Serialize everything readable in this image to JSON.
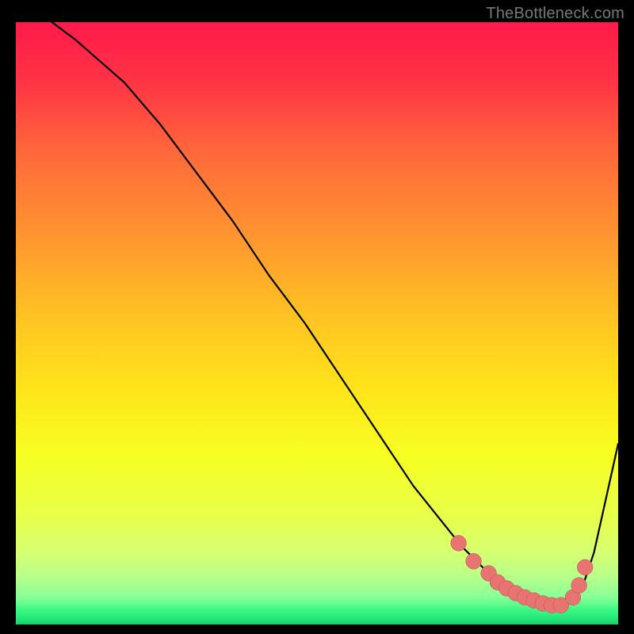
{
  "watermark": "TheBottleneck.com",
  "colors": {
    "background": "#000000",
    "watermark_text": "#777777",
    "curve_stroke": "#000000",
    "marker_fill": "#E77471",
    "marker_stroke": "#C0504D",
    "gradient_stops": [
      {
        "offset": 0.0,
        "color": "#FF1A4A"
      },
      {
        "offset": 0.1,
        "color": "#FF3445"
      },
      {
        "offset": 0.22,
        "color": "#FF6A3A"
      },
      {
        "offset": 0.35,
        "color": "#FF9330"
      },
      {
        "offset": 0.48,
        "color": "#FFC024"
      },
      {
        "offset": 0.6,
        "color": "#FFE21A"
      },
      {
        "offset": 0.72,
        "color": "#F7FF22"
      },
      {
        "offset": 0.82,
        "color": "#E8FF4A"
      },
      {
        "offset": 0.88,
        "color": "#D6FF70"
      },
      {
        "offset": 0.92,
        "color": "#B8FF8A"
      },
      {
        "offset": 0.955,
        "color": "#88FF98"
      },
      {
        "offset": 0.975,
        "color": "#40F884"
      },
      {
        "offset": 0.99,
        "color": "#22E77A"
      },
      {
        "offset": 1.0,
        "color": "#16D268"
      }
    ]
  },
  "chart_data": {
    "type": "line",
    "title": "",
    "xlabel": "",
    "ylabel": "",
    "xlim": [
      0,
      100
    ],
    "ylim": [
      0,
      100
    ],
    "grid": false,
    "legend": false,
    "series": [
      {
        "name": "curve",
        "x": [
          6,
          10,
          14,
          18,
          24,
          30,
          36,
          42,
          48,
          54,
          58,
          62,
          66,
          70,
          74,
          78,
          82,
          86,
          88,
          90,
          92,
          94,
          96,
          100
        ],
        "values": [
          100,
          97,
          93.5,
          90,
          83,
          75,
          67,
          58,
          50,
          41,
          35,
          29,
          23,
          18,
          13,
          9,
          6,
          4,
          3.2,
          3,
          3.5,
          6,
          12,
          30
        ]
      }
    ],
    "markers": {
      "x": [
        73.5,
        76,
        78.5,
        80,
        81.5,
        83,
        84.5,
        86,
        87.5,
        89,
        90.5,
        92.5,
        93.5,
        94.5
      ],
      "values": [
        13.5,
        10.5,
        8.5,
        7,
        6,
        5.2,
        4.5,
        4,
        3.5,
        3.2,
        3.2,
        4.5,
        6.5,
        9.5
      ],
      "radius_data_units": 1.3
    },
    "green_band": {
      "y_min": 0,
      "y_max": 4.5
    }
  }
}
